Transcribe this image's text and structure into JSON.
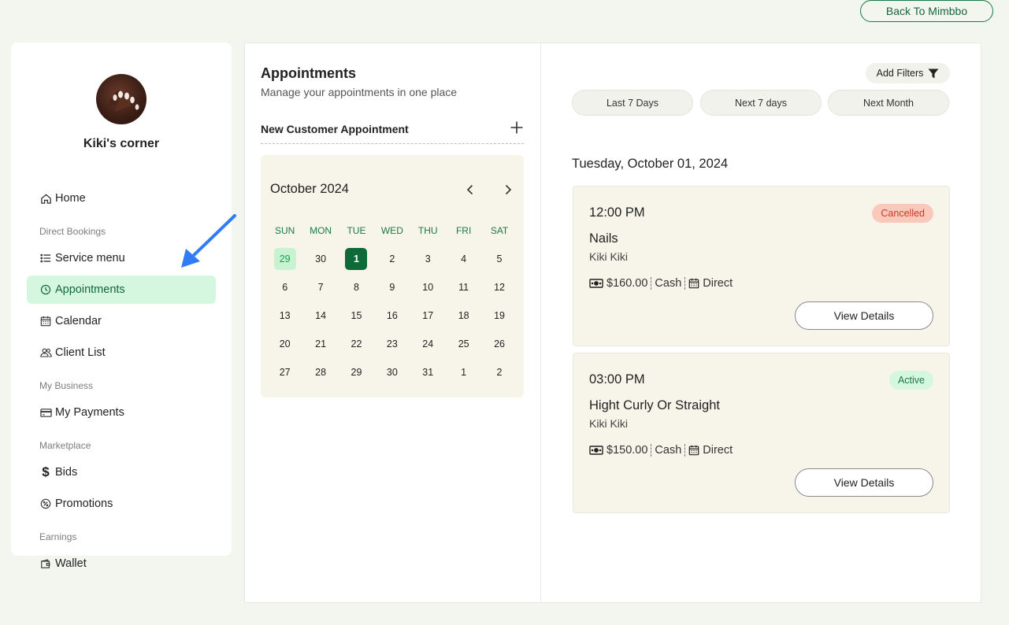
{
  "header": {
    "back_label": "Back To Mimbbo"
  },
  "sidebar": {
    "shop_name": "Kiki's corner",
    "items": [
      {
        "label": "Home"
      },
      {
        "section": "Direct Bookings"
      },
      {
        "label": "Service menu"
      },
      {
        "label": "Appointments",
        "active": true
      },
      {
        "label": "Calendar"
      },
      {
        "label": "Client List"
      },
      {
        "section": "My Business"
      },
      {
        "label": "My Payments"
      },
      {
        "section": "Marketplace"
      },
      {
        "label": "Bids"
      },
      {
        "label": "Promotions"
      },
      {
        "section": "Earnings"
      },
      {
        "label": "Wallet"
      }
    ]
  },
  "appointments": {
    "title": "Appointments",
    "subtitle": "Manage your appointments in one place",
    "new_label": "New Customer Appointment"
  },
  "calendar": {
    "month_label": "October 2024",
    "weekdays": [
      "SUN",
      "MON",
      "TUE",
      "WED",
      "THU",
      "FRI",
      "SAT"
    ],
    "weeks": [
      [
        "29",
        "30",
        "1",
        "2",
        "3",
        "4",
        "5"
      ],
      [
        "6",
        "7",
        "8",
        "9",
        "10",
        "11",
        "12"
      ],
      [
        "13",
        "14",
        "15",
        "16",
        "17",
        "18",
        "19"
      ],
      [
        "20",
        "21",
        "22",
        "23",
        "24",
        "25",
        "26"
      ],
      [
        "27",
        "28",
        "29",
        "30",
        "31",
        "1",
        "2"
      ]
    ],
    "today_cell": [
      0,
      0
    ],
    "selected_cell": [
      0,
      2
    ]
  },
  "filters": {
    "add_label": "Add Filters",
    "ranges": [
      "Last 7 Days",
      "Next 7 days",
      "Next Month"
    ]
  },
  "list": {
    "date_heading": "Tuesday, October 01, 2024",
    "cards": [
      {
        "time": "12:00 PM",
        "status": "Cancelled",
        "status_color": "#c93a2a",
        "service": "Nails",
        "client": "Kiki Kiki",
        "price": "$160.00",
        "payment": "Cash",
        "channel": "Direct",
        "action": "View Details"
      },
      {
        "time": "03:00 PM",
        "status": "Active",
        "status_color": "#1a7a45",
        "service": "Hight Curly Or Straight",
        "client": "Kiki Kiki",
        "price": "$150.00",
        "payment": "Cash",
        "channel": "Direct",
        "action": "View Details"
      }
    ]
  },
  "colors": {
    "accent": "#0f6a3a",
    "active_bg": "#d5f7df",
    "card_bg": "#f7f5ea",
    "arrow": "#2f7cf6"
  }
}
